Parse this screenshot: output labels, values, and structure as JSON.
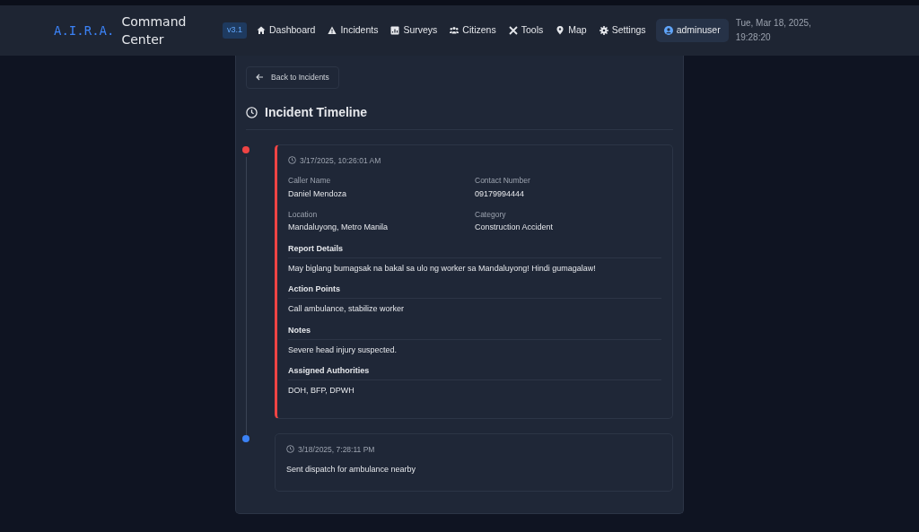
{
  "brand": {
    "acronym": "A.I.R.A.",
    "title_line1": "Command",
    "title_line2": "Center",
    "version": "v3.1"
  },
  "nav": [
    {
      "label": "Dashboard"
    },
    {
      "label": "Incidents"
    },
    {
      "label": "Surveys"
    },
    {
      "label": "Citizens"
    },
    {
      "label": "Tools"
    },
    {
      "label": "Map"
    },
    {
      "label": "Settings"
    }
  ],
  "user": "adminuser",
  "clock": {
    "date": "Tue, Mar 18, 2025,",
    "time": "19:28:20"
  },
  "back_button": "Back to Incidents",
  "heading": "Incident Timeline",
  "timeline": [
    {
      "kind": "report",
      "color": "#ef4444",
      "timestamp": "3/17/2025, 10:26:01 AM",
      "fields": [
        {
          "label": "Caller Name",
          "value": "Daniel Mendoza"
        },
        {
          "label": "Contact Number",
          "value": "09179994444"
        },
        {
          "label": "Location",
          "value": "Mandaluyong, Metro Manila"
        },
        {
          "label": "Category",
          "value": "Construction Accident"
        }
      ],
      "sections": [
        {
          "title": "Report Details",
          "text": "May biglang bumagsak na bakal sa ulo ng worker sa Mandaluyong! Hindi gumagalaw!"
        },
        {
          "title": "Action Points",
          "text": "Call ambulance, stabilize worker"
        },
        {
          "title": "Notes",
          "text": "Severe head injury suspected."
        },
        {
          "title": "Assigned Authorities",
          "text": "DOH, BFP, DPWH"
        }
      ]
    },
    {
      "kind": "update",
      "color": "#3b82f6",
      "timestamp": "3/18/2025, 7:28:11 PM",
      "text": "Sent dispatch for ambulance nearby"
    }
  ]
}
